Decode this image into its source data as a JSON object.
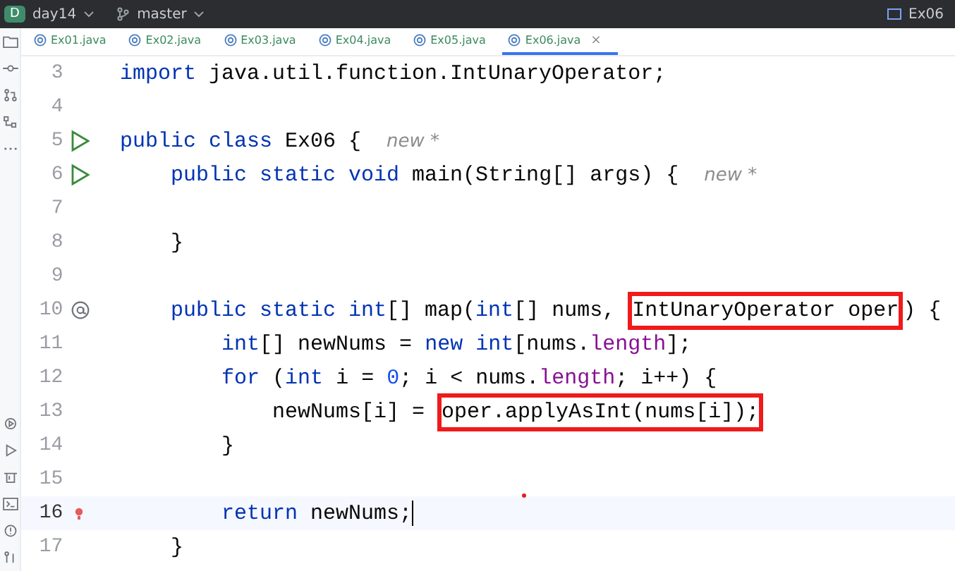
{
  "titlebar": {
    "project_badge": "D",
    "project": "day14",
    "branch": "master",
    "current_file": "Ex06"
  },
  "tabs": [
    {
      "label": "Ex01.java",
      "selected": false
    },
    {
      "label": "Ex02.java",
      "selected": false
    },
    {
      "label": "Ex03.java",
      "selected": false
    },
    {
      "label": "Ex04.java",
      "selected": false
    },
    {
      "label": "Ex05.java",
      "selected": false
    },
    {
      "label": "Ex06.java",
      "selected": true,
      "close": "×"
    }
  ],
  "lines": [
    {
      "number": "3",
      "current": false,
      "kind": "plain",
      "tokens": [
        {
          "kind": "kw",
          "text": "import"
        },
        {
          "kind": "plain",
          "text": " java.util.function.IntUnaryOperator;"
        }
      ]
    },
    {
      "number": "4",
      "current": false,
      "kind": "plain"
    },
    {
      "number": "5",
      "current": false,
      "kind": "run",
      "tokens": [
        {
          "kind": "kw",
          "text": "public class"
        },
        {
          "kind": "plain",
          "text": " Ex06 {  "
        },
        {
          "kind": "hint",
          "text": "new *"
        }
      ]
    },
    {
      "number": "6",
      "current": false,
      "kind": "run",
      "tokens": [
        {
          "kind": "kw",
          "text": "    public static void"
        },
        {
          "kind": "plain",
          "text": " main(String[] args) {  "
        },
        {
          "kind": "hint",
          "text": "new *"
        }
      ]
    },
    {
      "number": "7",
      "current": false,
      "kind": "plain"
    },
    {
      "number": "8",
      "current": false,
      "kind": "plain",
      "tokens": [
        {
          "kind": "plain",
          "text": "    }"
        }
      ]
    },
    {
      "number": "9",
      "current": false,
      "kind": "plain"
    },
    {
      "number": "10",
      "current": false,
      "kind": "override",
      "tokens": [
        {
          "kind": "kw",
          "text": "    public static int"
        },
        {
          "kind": "plain",
          "text": "[] map("
        },
        {
          "kind": "kw",
          "text": "int"
        },
        {
          "kind": "plain",
          "text": "[] nums, "
        },
        {
          "kind": "boxed",
          "text": "IntUnaryOperator oper"
        },
        {
          "kind": "plain",
          "text": ") {"
        }
      ]
    },
    {
      "number": "11",
      "current": false,
      "kind": "plain",
      "tokens": [
        {
          "kind": "kw",
          "text": "        int"
        },
        {
          "kind": "plain",
          "text": "[] newNums = "
        },
        {
          "kind": "kw",
          "text": "new int"
        },
        {
          "kind": "plain",
          "text": "[nums."
        },
        {
          "kind": "field",
          "text": "length"
        },
        {
          "kind": "plain",
          "text": "];"
        }
      ]
    },
    {
      "number": "12",
      "current": false,
      "kind": "plain",
      "tokens": [
        {
          "kind": "kw",
          "text": "        for"
        },
        {
          "kind": "plain",
          "text": " ("
        },
        {
          "kind": "kw",
          "text": "int"
        },
        {
          "kind": "plain",
          "text": " i = "
        },
        {
          "kind": "num",
          "text": "0"
        },
        {
          "kind": "plain",
          "text": "; i < nums."
        },
        {
          "kind": "field",
          "text": "length"
        },
        {
          "kind": "plain",
          "text": "; i++) {"
        }
      ]
    },
    {
      "number": "13",
      "current": false,
      "kind": "plain",
      "tokens": [
        {
          "kind": "plain",
          "text": "            newNums[i] = "
        },
        {
          "kind": "boxed",
          "text": "oper.applyAsInt(nums[i]);"
        }
      ]
    },
    {
      "number": "14",
      "current": false,
      "kind": "plain",
      "tokens": [
        {
          "kind": "plain",
          "text": "        }"
        }
      ]
    },
    {
      "number": "15",
      "current": false,
      "kind": "plain"
    },
    {
      "number": "16",
      "current": true,
      "kind": "bulb",
      "tokens": [
        {
          "kind": "kw",
          "text": "        return"
        },
        {
          "kind": "plain",
          "text": " newNums;"
        }
      ]
    },
    {
      "number": "17",
      "current": false,
      "kind": "plain",
      "tokens": [
        {
          "kind": "plain",
          "text": "    }"
        }
      ]
    }
  ]
}
